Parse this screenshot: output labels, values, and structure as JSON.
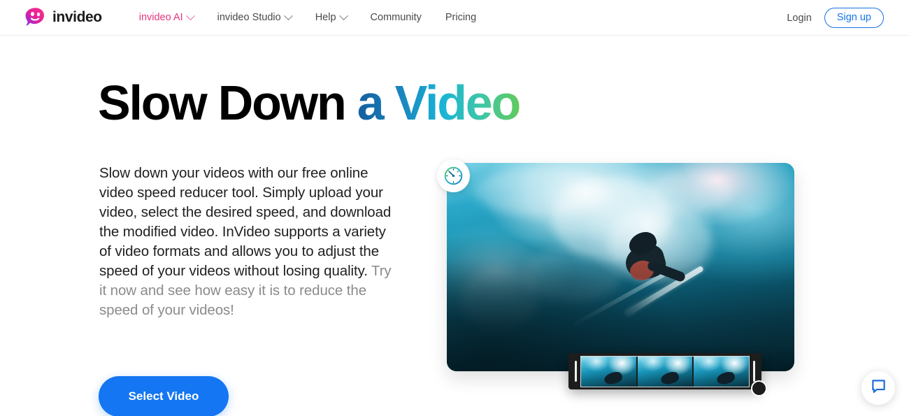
{
  "header": {
    "logo": {
      "icon": "invideo-logo-icon",
      "text": "invideo"
    },
    "nav": [
      {
        "label": "invideo AI",
        "has_chevron": true,
        "accent": true,
        "color": "#e8357f"
      },
      {
        "label": "invideo Studio",
        "has_chevron": true,
        "accent": false
      },
      {
        "label": "Help",
        "has_chevron": true,
        "accent": false
      },
      {
        "label": "Community",
        "has_chevron": false,
        "accent": false
      },
      {
        "label": "Pricing",
        "has_chevron": false,
        "accent": false
      }
    ],
    "login_label": "Login",
    "signup_label": "Sign up",
    "signup_color": "#1573e6"
  },
  "hero": {
    "title_plain": "Slow Down ",
    "title_gradient": "a Video",
    "gradient_colors": [
      "#135f9f",
      "#18b4d6",
      "#62cb5c"
    ],
    "body_strong": "Slow down your videos with our free online video speed reducer tool. Simply upload your video, select the desired speed, and download the modified video. InVideo supports a variety of video formats and allows you to adjust the speed of your videos without losing quality.",
    "body_muted": " Try it now and see how easy it is to reduce the speed of your videos!",
    "cta_label": "Select Video",
    "cta_color": "#1476f2"
  },
  "preview": {
    "badge_icon": "speedometer-icon",
    "media_alt": "underwater-surfer-photo",
    "timeline": {
      "left_handle": "trim-handle-left",
      "right_handle": "trim-handle-right",
      "frame_count": 3,
      "drag_handle": "timeline-drag-handle"
    }
  },
  "chat": {
    "icon": "chat-bubble-icon",
    "color": "#1b6ddb"
  }
}
